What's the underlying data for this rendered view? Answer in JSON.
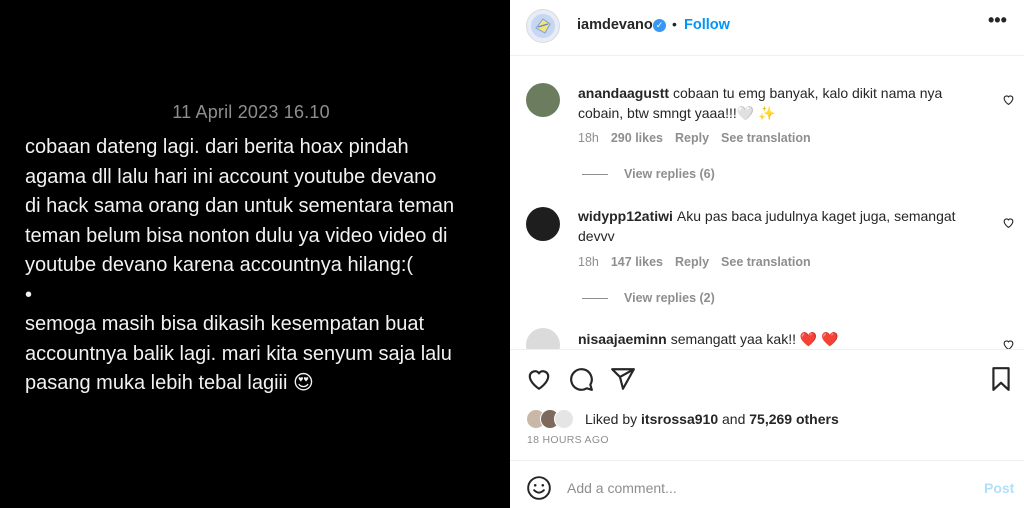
{
  "post": {
    "date_text": "11 April 2023 16.10",
    "caption": "cobaan dateng lagi. dari berita hoax pindah\nagama dll lalu hari ini account youtube devano\ndi hack sama orang dan untuk sementara teman\nteman belum bisa nonton dulu ya video video di\nyoutube devano karena accountnya hilang:(\n•\nsemoga masih bisa dikasih kesempatan buat\naccountnya balik lagi. mari kita senyum saja lalu\npasang muka lebih tebal lagiii 😍"
  },
  "header": {
    "username": "iamdevano",
    "verified_icon": "verified-badge-icon",
    "separator": "•",
    "follow_label": "Follow",
    "more_label": "•••"
  },
  "comments": [
    {
      "username": "anandaagustt",
      "text": "cobaan tu emg banyak, kalo dikit nama nya cobain, btw smngt yaaa!!!🤍 ✨",
      "age": "18h",
      "likes": "290 likes",
      "reply_label": "Reply",
      "translate_label": "See translation",
      "view_replies": "View replies (6)",
      "avatar_color": "#6b7d5e"
    },
    {
      "username": "widypp12atiwi",
      "text": "Aku pas baca judulnya kaget juga, semangat devvv",
      "age": "18h",
      "likes": "147 likes",
      "reply_label": "Reply",
      "translate_label": "See translation",
      "view_replies": "View replies (2)",
      "avatar_color": "#1e1e1e"
    },
    {
      "username": "nisaajaeminn",
      "text": "semangatt yaa kak!! ❤️ ❤️",
      "avatar_color": "#dbdbdb"
    }
  ],
  "actions": {
    "like_icon": "heart-icon",
    "comment_icon": "comment-icon",
    "share_icon": "share-icon",
    "save_icon": "bookmark-icon"
  },
  "likes": {
    "prefix": "Liked by",
    "user": "itsrossa910",
    "middle": "and",
    "others": "75,269 others"
  },
  "timestamp": "18 HOURS AGO",
  "add_comment": {
    "placeholder": "Add a comment...",
    "post_label": "Post",
    "emoji_icon": "emoji-icon"
  },
  "colors": {
    "accent": "#0095f6",
    "verified": "#3897f0",
    "muted": "#8e8e8e",
    "post_disabled": "#b2dffc"
  }
}
